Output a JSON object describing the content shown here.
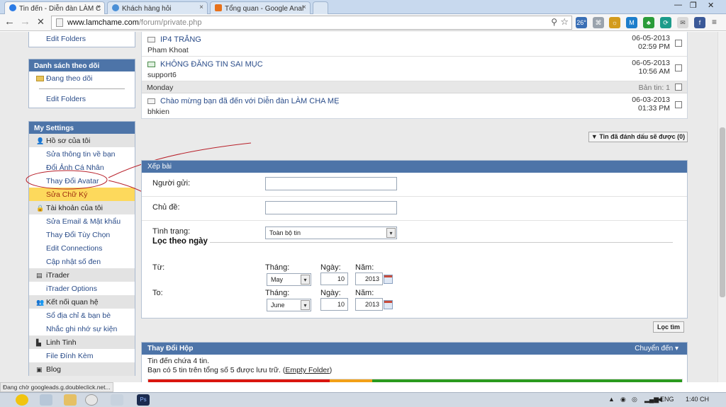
{
  "browser": {
    "tabs": [
      {
        "label": "Tin đến - Diễn đàn LÀM C",
        "color": "#2c7be5"
      },
      {
        "label": "Khách hàng hỏi",
        "color": "#4a8fd6"
      },
      {
        "label": "Tổng quan - Google Anal",
        "color": "#e7711b"
      }
    ],
    "url_host": "www.lamchame.com",
    "url_path": "/forum/private.php",
    "weather": "26°",
    "status": "Đang chờ googleads.g.doubleclick.net..."
  },
  "sidebar": {
    "top_item": "Edit Folders",
    "watch": {
      "heading": "Danh sách theo dõi",
      "item": "Đang theo dõi",
      "edit": "Edit Folders"
    },
    "settings": {
      "heading": "My Settings",
      "profile_group": "Hồ sơ của tôi",
      "profile_items": [
        "Sửa thông tin về bạn",
        "Đổi Ảnh Cá Nhân",
        "Thay Đổi Avatar",
        "Sửa Chữ Ký"
      ],
      "account_group": "Tài khoản của tôi",
      "account_items": [
        "Sửa Email & Mật khẩu",
        "Thay Đổi Tùy Chọn",
        "Edit Connections",
        "Cập nhật số đen"
      ],
      "itrader_group": "iTrader",
      "itrader_items": [
        "iTrader Options"
      ],
      "network_group": "Kết nối quan hệ",
      "network_items": [
        "Sổ địa chỉ & bạn bè",
        "Nhắc ghi nhớ sự kiện"
      ],
      "misc_group": "Linh Tinh",
      "misc_items": [
        "File Đính Kèm"
      ],
      "blog_group": "Blog"
    }
  },
  "messages": {
    "rows1": [
      {
        "title": "IP4 TRẮNG",
        "sender": "Pham Khoat",
        "date": "06-05-2013",
        "time": "02:59 PM"
      },
      {
        "title": "KHÔNG ĐĂNG TIN SAI MỤC",
        "sender": "support6",
        "date": "06-05-2013",
        "time": "10:56 AM"
      }
    ],
    "group": {
      "label": "Monday",
      "count": "Bản tin: 1"
    },
    "rows2": [
      {
        "title": "Chào mừng bạn đã đến với Diễn đàn LÀM CHA MẸ",
        "sender": "bhkien",
        "date": "06-03-2013",
        "time": "01:33 PM"
      }
    ],
    "marked_button": "▼ Tin đã đánh dấu sẽ được (0)"
  },
  "filter": {
    "heading": "Xếp bài",
    "sender_label": "Người gửi:",
    "subject_label": "Chủ đề:",
    "status_label": "Tình trạng:",
    "status_value": "Toàn bộ tin",
    "date_heading": "Lọc theo ngày",
    "from_label": "Từ:",
    "to_label": "To:",
    "month_label": "Tháng:",
    "day_label": "Ngày:",
    "year_label": "Năm:",
    "from": {
      "month": "May",
      "day": "10",
      "year": "2013"
    },
    "to": {
      "month": "June",
      "day": "10",
      "year": "2013"
    },
    "search_button": "Lọc tìm"
  },
  "movebox": {
    "heading": "Thay Đổi Hộp",
    "jump": "Chuyển đến ▾",
    "line1": "Tin đến chứa 4 tin.",
    "line2_prefix": "Bạn có 5 tin trên tổng số 5 được lưu trữ. (",
    "line2_link": "Empty Folder",
    "line2_suffix": ")",
    "usage_segments": [
      {
        "color": "#d9160f",
        "fraction": 0.34
      },
      {
        "color": "#f2a017",
        "fraction": 0.08
      },
      {
        "color": "#2a9a1e",
        "fraction": 0.58
      }
    ]
  },
  "taskbar": {
    "lang": "ENG",
    "clock": "1:40 CH"
  }
}
